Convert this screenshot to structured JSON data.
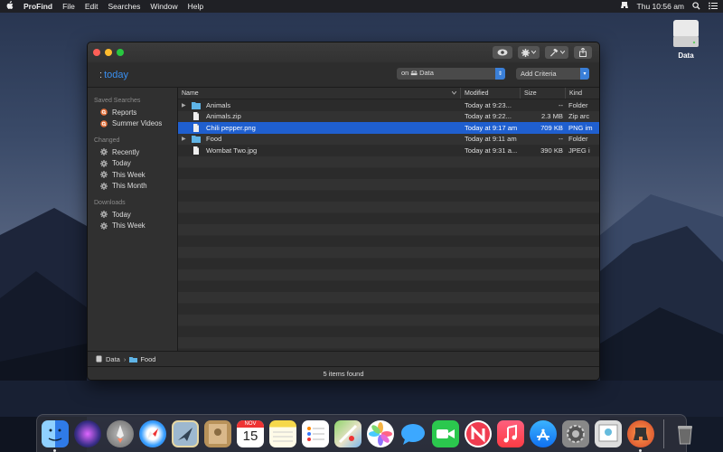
{
  "menubar": {
    "app_name": "ProFind",
    "items": [
      "File",
      "Edit",
      "Searches",
      "Window",
      "Help"
    ],
    "clock": "Thu 10:56 am"
  },
  "desktop": {
    "drive_label": "Data"
  },
  "window": {
    "query_prefix": ":",
    "query_text": "today",
    "scope_label": "on 🖴 Data",
    "add_criteria_label": "Add Criteria"
  },
  "sidebar": {
    "saved_searches_heading": "Saved Searches",
    "saved_searches": [
      {
        "label": "Reports",
        "icon": "search-icon"
      },
      {
        "label": "Summer Videos",
        "icon": "search-icon"
      }
    ],
    "changed_heading": "Changed",
    "changed": [
      {
        "label": "Recently",
        "icon": "gear-icon"
      },
      {
        "label": "Today",
        "icon": "gear-icon"
      },
      {
        "label": "This Week",
        "icon": "gear-icon"
      },
      {
        "label": "This Month",
        "icon": "gear-icon"
      }
    ],
    "downloads_heading": "Downloads",
    "downloads": [
      {
        "label": "Today",
        "icon": "gear-icon"
      },
      {
        "label": "This Week",
        "icon": "gear-icon"
      }
    ]
  },
  "table": {
    "columns": [
      "Name",
      "Modified",
      "Size",
      "Kind"
    ],
    "rows": [
      {
        "name": "Animals",
        "modified": "Today at 9:23...",
        "size": "--",
        "kind": "Folder",
        "type": "folder",
        "expandable": true,
        "selected": false
      },
      {
        "name": "Animals.zip",
        "modified": "Today at 9:22...",
        "size": "2.3 MB",
        "kind": "Zip arc",
        "type": "file",
        "expandable": false,
        "selected": false
      },
      {
        "name": "Chili pepper.png",
        "modified": "Today at 9:17 am",
        "size": "709 KB",
        "kind": "PNG im",
        "type": "file",
        "expandable": false,
        "selected": true
      },
      {
        "name": "Food",
        "modified": "Today at 9:11 am",
        "size": "--",
        "kind": "Folder",
        "type": "folder",
        "expandable": true,
        "selected": false
      },
      {
        "name": "Wombat Two.jpg",
        "modified": "Today at 9:31 a...",
        "size": "390 KB",
        "kind": "JPEG i",
        "type": "file",
        "expandable": false,
        "selected": false
      }
    ]
  },
  "pathbar": {
    "items": [
      "Data",
      "Food"
    ]
  },
  "status": {
    "text": "5 items found"
  },
  "dock": {
    "calendar_month": "NOV",
    "calendar_day": "15",
    "apps": [
      "finder",
      "siri",
      "launchpad",
      "safari",
      "mail",
      "contacts",
      "calendar",
      "notes",
      "reminders",
      "maps",
      "photos",
      "messages",
      "facetime",
      "news",
      "music",
      "app-store",
      "system-preferences",
      "preview",
      "profind",
      "trash"
    ]
  },
  "colors": {
    "accent": "#1f5fcf",
    "link": "#3a8ff0"
  }
}
